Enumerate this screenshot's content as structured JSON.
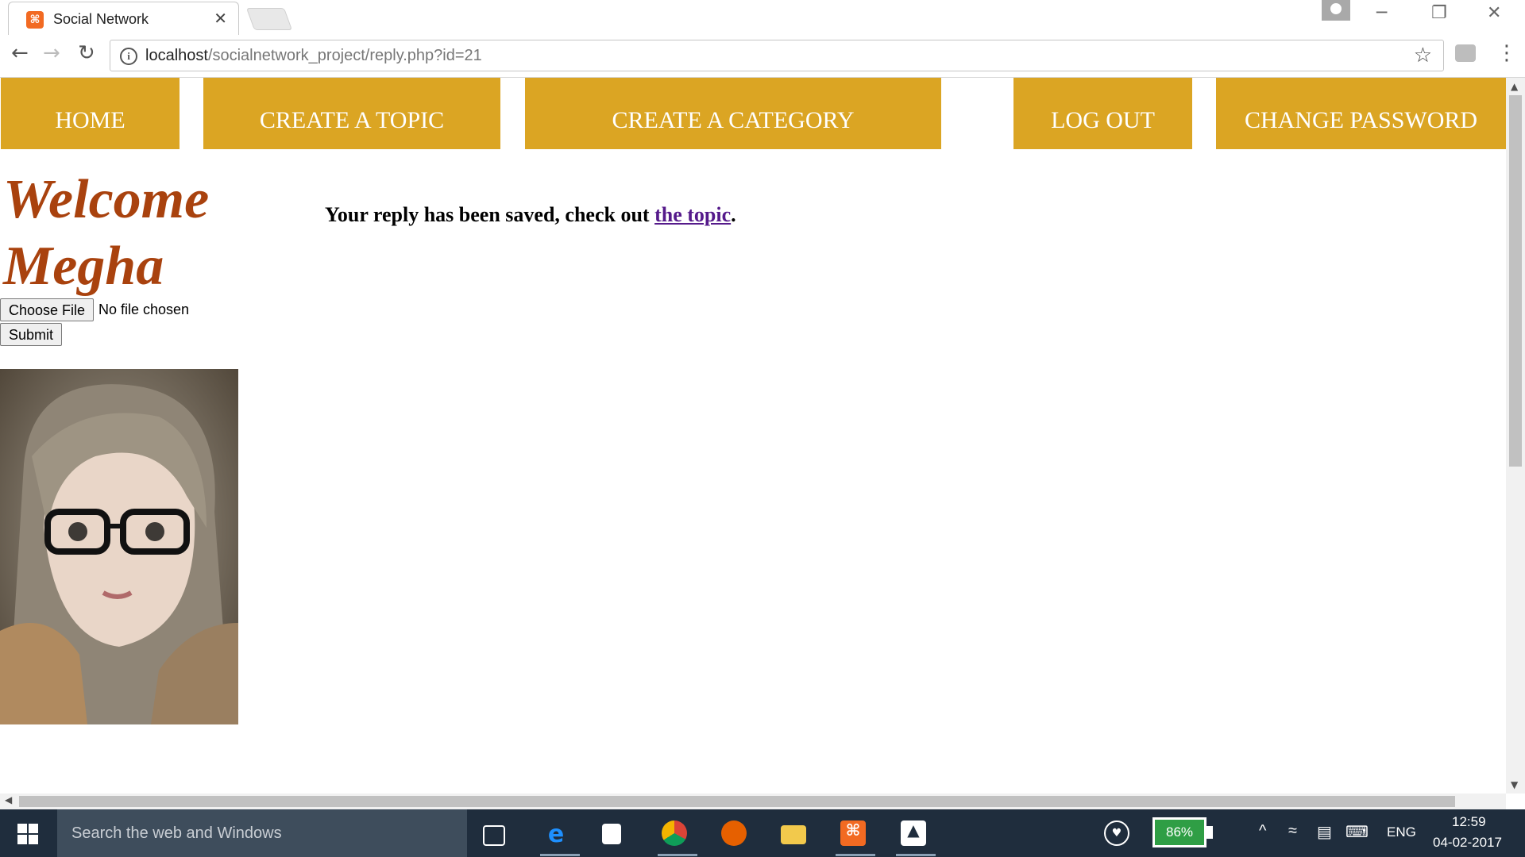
{
  "browser": {
    "tab_title": "Social Network",
    "tab_favicon": "xampp-icon",
    "url_host": "localhost",
    "url_path": "/socialnetwork_project/reply.php?id=21"
  },
  "nav": {
    "home": "HOME",
    "create_topic": "CREATE A TOPIC",
    "create_category": "CREATE A CATEGORY",
    "logout": "LOG OUT",
    "change_password": "CHANGE PASSWORD"
  },
  "sidebar": {
    "welcome": "Welcome Megha",
    "choose_file": "Choose File",
    "file_status": "No file chosen",
    "submit": "Submit"
  },
  "message": {
    "text": "Your reply has been saved, check out ",
    "link": "the topic",
    "end": "."
  },
  "taskbar": {
    "search_placeholder": "Search the web and Windows",
    "battery": "86%",
    "language": "ENG",
    "time": "12:59",
    "date": "04-02-2017"
  },
  "colors": {
    "nav_bg": "#dba523",
    "welcome_text": "#a9420e",
    "link": "#551a8b"
  }
}
